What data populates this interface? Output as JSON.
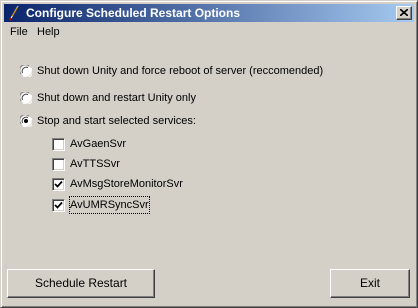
{
  "window": {
    "title": "Configure Scheduled Restart Options",
    "title_icon": "feather-icon",
    "close_icon": "close-icon"
  },
  "menu": {
    "items": [
      "File",
      "Help"
    ]
  },
  "options": {
    "selected": 2,
    "radios": [
      {
        "label": "Shut down Unity and force reboot of server (reccomended)",
        "checked": false
      },
      {
        "label": "Shut down and restart Unity only",
        "checked": false
      },
      {
        "label": "Stop and start selected services:",
        "checked": true
      }
    ],
    "services": [
      {
        "label": "AvGaenSvr",
        "checked": false
      },
      {
        "label": "AvTTSSvr",
        "checked": false
      },
      {
        "label": "AvMsgStoreMonitorSvr",
        "checked": true
      },
      {
        "label": "AvUMRSyncSvr",
        "checked": true,
        "focused": true
      }
    ]
  },
  "buttons": {
    "schedule": "Schedule Restart",
    "exit": "Exit"
  },
  "colors": {
    "face": "#d4d0c8",
    "title_start": "#0a246a",
    "title_end": "#a6caf0"
  }
}
